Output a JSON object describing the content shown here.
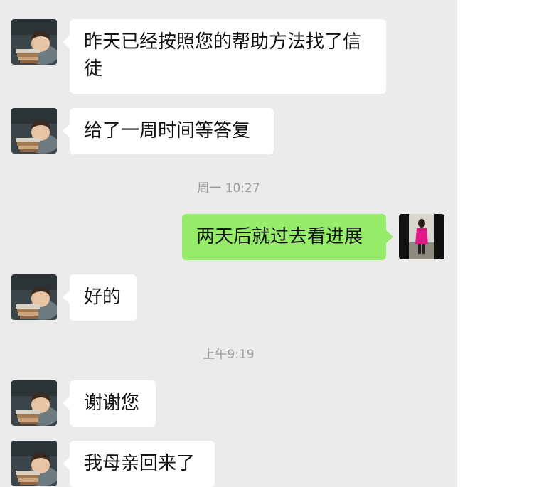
{
  "messages": [
    {
      "sender": "contact",
      "avatar": "contact-avatar",
      "text": "昨天已经按照您的帮助方法找了信徒"
    },
    {
      "sender": "contact",
      "avatar": "contact-avatar",
      "text": "给了一周时间等答复"
    },
    {
      "type": "timestamp",
      "text": "周一 10:27"
    },
    {
      "sender": "me",
      "avatar": "user-avatar",
      "text": "两天后就过去看进展"
    },
    {
      "sender": "contact",
      "avatar": "contact-avatar",
      "text": "好的"
    },
    {
      "type": "timestamp",
      "text": "上午9:19"
    },
    {
      "sender": "contact",
      "avatar": "contact-avatar",
      "text": "谢谢您"
    },
    {
      "sender": "contact",
      "avatar": "contact-avatar",
      "text": "我母亲回来了"
    }
  ],
  "colors": {
    "chat_background": "#ebebeb",
    "incoming_bubble": "#ffffff",
    "outgoing_bubble": "#95ec69",
    "timestamp_text": "#9a9a9a"
  }
}
